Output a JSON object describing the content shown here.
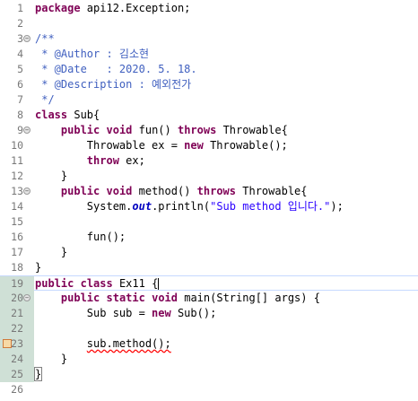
{
  "editor": {
    "lines": [
      {
        "num": "1",
        "fold": false,
        "tokens": [
          [
            "kw",
            "package"
          ],
          [
            "t",
            " api12.Exception;"
          ]
        ]
      },
      {
        "num": "2",
        "fold": false,
        "tokens": []
      },
      {
        "num": "3",
        "fold": true,
        "fold_symbol": "−",
        "tokens": [
          [
            "cm",
            "/**"
          ]
        ]
      },
      {
        "num": "4",
        "fold": false,
        "tokens": [
          [
            "cm",
            " * @Author : 김소현"
          ]
        ]
      },
      {
        "num": "5",
        "fold": false,
        "tokens": [
          [
            "cm",
            " * @Date   : 2020. 5. 18."
          ]
        ]
      },
      {
        "num": "6",
        "fold": false,
        "tokens": [
          [
            "cm",
            " * @Description : 예외전가"
          ]
        ]
      },
      {
        "num": "7",
        "fold": false,
        "tokens": [
          [
            "cm",
            " */"
          ]
        ]
      },
      {
        "num": "8",
        "fold": false,
        "tokens": [
          [
            "kw",
            "class"
          ],
          [
            "t",
            " Sub{"
          ]
        ]
      },
      {
        "num": "9",
        "fold": true,
        "fold_symbol": "−",
        "tokens": [
          [
            "t",
            "    "
          ],
          [
            "kw",
            "public"
          ],
          [
            "t",
            " "
          ],
          [
            "kw",
            "void"
          ],
          [
            "t",
            " fun() "
          ],
          [
            "kw",
            "throws"
          ],
          [
            "t",
            " Throwable{"
          ]
        ]
      },
      {
        "num": "10",
        "fold": false,
        "tokens": [
          [
            "t",
            "        Throwable ex = "
          ],
          [
            "kw",
            "new"
          ],
          [
            "t",
            " Throwable();"
          ]
        ]
      },
      {
        "num": "11",
        "fold": false,
        "tokens": [
          [
            "t",
            "        "
          ],
          [
            "kw",
            "throw"
          ],
          [
            "t",
            " ex;"
          ]
        ]
      },
      {
        "num": "12",
        "fold": false,
        "tokens": [
          [
            "t",
            "    }"
          ]
        ]
      },
      {
        "num": "13",
        "fold": true,
        "fold_symbol": "−",
        "tokens": [
          [
            "t",
            "    "
          ],
          [
            "kw",
            "public"
          ],
          [
            "t",
            " "
          ],
          [
            "kw",
            "void"
          ],
          [
            "t",
            " method() "
          ],
          [
            "kw",
            "throws"
          ],
          [
            "t",
            " Throwable{"
          ]
        ]
      },
      {
        "num": "14",
        "fold": false,
        "tokens": [
          [
            "t",
            "        System."
          ],
          [
            "fld",
            "out"
          ],
          [
            "t",
            ".println("
          ],
          [
            "str",
            "\"Sub method 입니다.\""
          ],
          [
            "t",
            ");"
          ]
        ]
      },
      {
        "num": "15",
        "fold": false,
        "tokens": []
      },
      {
        "num": "16",
        "fold": false,
        "tokens": [
          [
            "t",
            "        fun();"
          ]
        ]
      },
      {
        "num": "17",
        "fold": false,
        "tokens": [
          [
            "t",
            "    }"
          ]
        ]
      },
      {
        "num": "18",
        "fold": false,
        "tokens": [
          [
            "t",
            "}"
          ]
        ]
      },
      {
        "num": "19",
        "fold": false,
        "current": true,
        "tokens": [
          [
            "kw",
            "public"
          ],
          [
            "t",
            " "
          ],
          [
            "kw",
            "class"
          ],
          [
            "t",
            " Ex11 {"
          ],
          [
            "caret",
            ""
          ]
        ]
      },
      {
        "num": "20",
        "fold": true,
        "fold_symbol": "−",
        "tokens": [
          [
            "t",
            "    "
          ],
          [
            "kw",
            "public"
          ],
          [
            "t",
            " "
          ],
          [
            "kw",
            "static"
          ],
          [
            "t",
            " "
          ],
          [
            "kw",
            "void"
          ],
          [
            "t",
            " main(String[] args) {"
          ]
        ]
      },
      {
        "num": "21",
        "fold": false,
        "tokens": [
          [
            "t",
            "        Sub sub = "
          ],
          [
            "kw",
            "new"
          ],
          [
            "t",
            " Sub();"
          ]
        ]
      },
      {
        "num": "22",
        "fold": false,
        "tokens": []
      },
      {
        "num": "23",
        "fold": false,
        "error": true,
        "tokens": [
          [
            "t",
            "        "
          ],
          [
            "err",
            "sub.method();"
          ]
        ]
      },
      {
        "num": "24",
        "fold": false,
        "tokens": [
          [
            "t",
            "    }"
          ]
        ]
      },
      {
        "num": "25",
        "fold": false,
        "tokens": [
          [
            "brace",
            "}"
          ]
        ]
      },
      {
        "num": "26",
        "fold": false,
        "tokens": []
      }
    ],
    "highlight_gutter_lines": [
      "19",
      "20",
      "21",
      "22",
      "23",
      "24",
      "25"
    ]
  },
  "colors": {
    "keyword": "#7f0055",
    "comment": "#3f5fbf",
    "string": "#2a00ff",
    "static_field": "#0000c0",
    "line_number": "#787878",
    "error": "#ff0000"
  }
}
